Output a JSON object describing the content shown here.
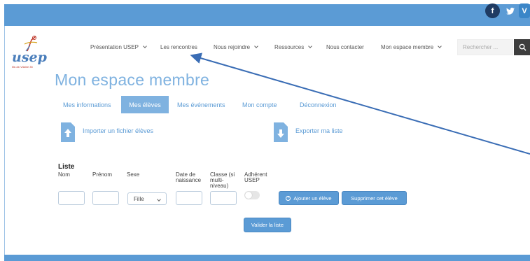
{
  "social": {
    "facebook": "f",
    "twitter": "•",
    "vimeo": "V"
  },
  "logo": {
    "text": "usep",
    "sub": "Ille-de-Vilaine 35"
  },
  "nav": {
    "items": [
      {
        "label": "Présentation USEP",
        "dropdown": true
      },
      {
        "label": "Les rencontres",
        "dropdown": false
      },
      {
        "label": "Nous rejoindre",
        "dropdown": true
      },
      {
        "label": "Ressources",
        "dropdown": true
      },
      {
        "label": "Nous contacter",
        "dropdown": false
      },
      {
        "label": "Mon espace membre",
        "dropdown": true
      }
    ],
    "search_placeholder": "Rechercher ..."
  },
  "page": {
    "title": "Mon espace membre"
  },
  "tabs": [
    {
      "label": "Mes informations",
      "active": false
    },
    {
      "label": "Mes élèves",
      "active": true
    },
    {
      "label": "Mes événements",
      "active": false
    },
    {
      "label": "Mon compte",
      "active": false
    },
    {
      "label": "Déconnexion",
      "active": false
    }
  ],
  "actions": {
    "import_label": "Importer un fichier élèves",
    "export_label": "Exporter ma liste"
  },
  "list": {
    "title": "Liste",
    "columns": {
      "nom": "Nom",
      "prenom": "Prénom",
      "sexe": "Sexe",
      "date_1": "Date de",
      "date_2": "naissance",
      "classe_1": "Classe (si",
      "classe_2": "multi-",
      "classe_3": "niveau)",
      "adherent_1": "Adhérent",
      "adherent_2": "USEP"
    },
    "sexe_value": "Fille",
    "add_label": "Ajouter un élève",
    "delete_label": "Supprimer cet élève",
    "validate_label": "Valider la liste"
  },
  "colors": {
    "topbar": "#5b9bd5",
    "accent": "#7fb2e0",
    "annotation_arrow": "#3a6db5"
  }
}
